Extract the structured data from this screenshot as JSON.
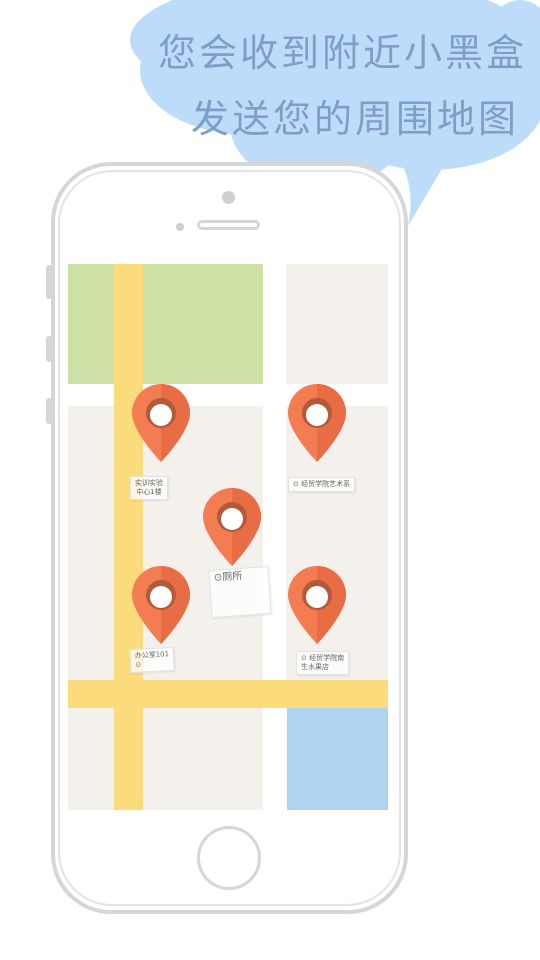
{
  "banner": {
    "line1": "您会收到附近小黑盒",
    "line2": "发送您的周围地图"
  },
  "locations": [
    {
      "name": "实训实验\n中心1楼"
    },
    {
      "name": "⊙ 经贸学院艺术系"
    },
    {
      "name": "⊙厕所"
    },
    {
      "name": "办公室101\n⊙"
    },
    {
      "name": "⊙ 经贸学院南\n生水果店"
    }
  ],
  "colors": {
    "cloud": "#bcdcfa",
    "banner_text": "#7c9fc7",
    "pin": "#f47c52",
    "road": "#fbdb7c",
    "park": "#cde1a6",
    "water": "#b0d4f0",
    "block": "#f4f1ec"
  }
}
